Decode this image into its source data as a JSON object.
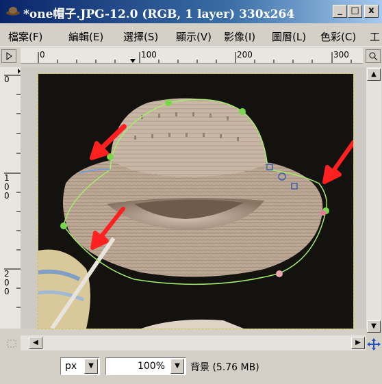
{
  "window": {
    "title": "*one帽子.JPG-12.0 (RGB, 1 layer) 330x264",
    "minimize": "_",
    "maximize": "□",
    "close": "x"
  },
  "menu": [
    "檔案(F)",
    "編輯(E)",
    "選擇(S)",
    "顯示(V)",
    "影像(I)",
    "圖層(L)",
    "色彩(C)",
    "工"
  ],
  "ruler": {
    "h_labels": [
      "0",
      "100",
      "200",
      "300"
    ],
    "v_labels": [
      "0",
      "1\n0\n0",
      "2\n0\n0"
    ]
  },
  "statusbar": {
    "unit": "px",
    "zoom": "100%",
    "info": "背景 (5.76 MB)"
  },
  "colors": {
    "titlebar_start": "#0a246a",
    "path_stroke": "#9adf6a",
    "arrow": "#ff2020"
  }
}
